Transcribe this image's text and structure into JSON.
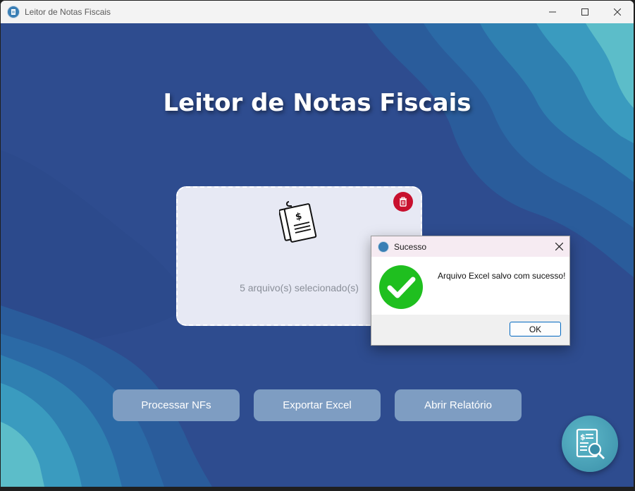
{
  "window": {
    "title": "Leitor de Notas Fiscais",
    "controls": [
      "minimize-icon",
      "maximize-icon",
      "close-icon"
    ]
  },
  "main": {
    "title": "Leitor de Notas Fiscais",
    "dropzone": {
      "status_text": "5 arquivo(s) selecionado(s)",
      "icons": [
        "invoice-document-icon",
        "trash-icon"
      ]
    },
    "buttons": {
      "process": "Processar NFs",
      "export": "Exportar Excel",
      "report": "Abrir Relatório"
    },
    "fab_icon": "invoice-search-icon"
  },
  "dialog": {
    "title": "Sucesso",
    "message": "Arquivo Excel salvo com sucesso!",
    "ok_label": "OK",
    "icon": "success-check-icon"
  },
  "colors": {
    "background": "#2e4c8f",
    "button": "#7e9dc2",
    "delete": "#c8102e",
    "success": "#1fbf1f"
  }
}
